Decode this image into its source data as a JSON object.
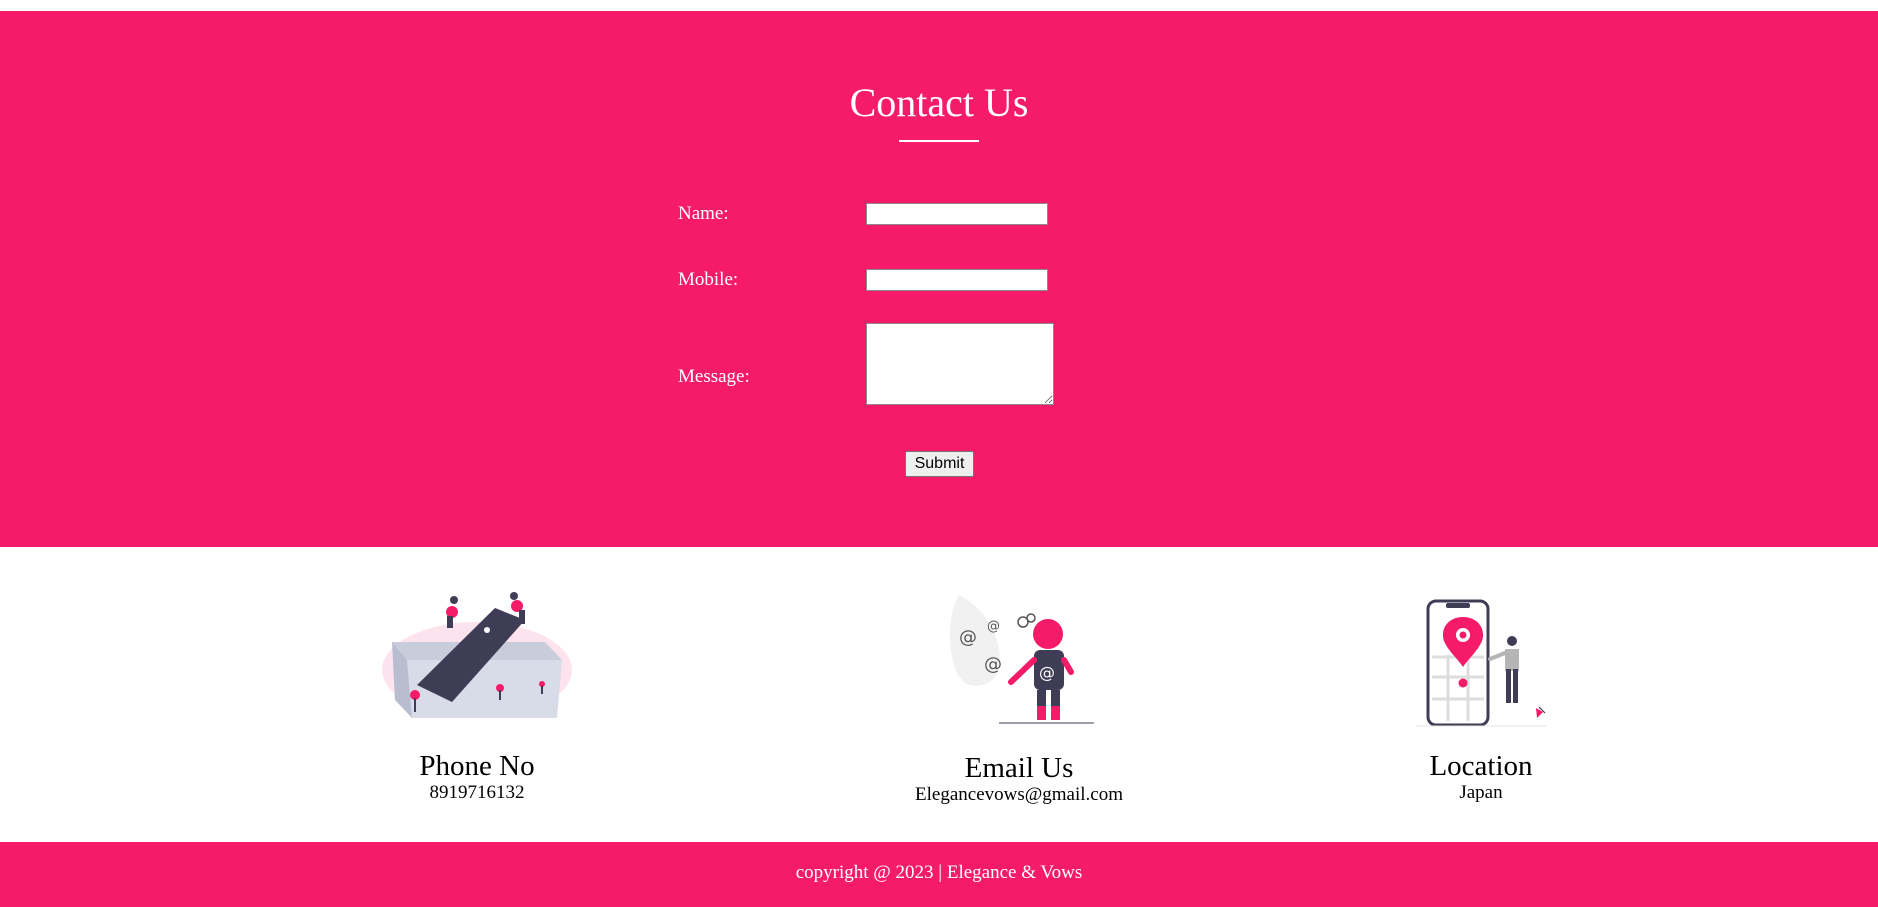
{
  "colors": {
    "accent": "#f61b68",
    "text_light": "#ffffff",
    "text_dark": "#000000"
  },
  "contact": {
    "title": "Contact Us",
    "form": {
      "name_label": "Name:",
      "name_value": "",
      "mobile_label": "Mobile:",
      "mobile_value": "",
      "message_label": "Message:",
      "message_value": "",
      "submit_label": "Submit"
    }
  },
  "info": {
    "phone": {
      "icon": "phone-box-illustration",
      "heading": "Phone No",
      "value": "8919716132"
    },
    "email": {
      "icon": "email-person-illustration",
      "heading": "Email Us",
      "value": "Elegancevows@gmail.com"
    },
    "location": {
      "icon": "location-map-illustration",
      "heading": "Location",
      "value": "Japan"
    }
  },
  "footer": {
    "copyright": "copyright @ 2023 | Elegance & Vows"
  }
}
